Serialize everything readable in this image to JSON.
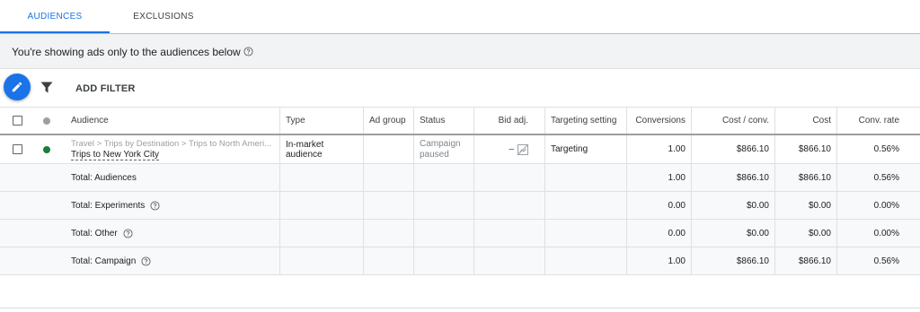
{
  "tabs": [
    {
      "label": "AUDIENCES",
      "active": true
    },
    {
      "label": "EXCLUSIONS",
      "active": false
    }
  ],
  "info_bar": {
    "text": "You're showing ads only to the audiences below"
  },
  "toolbar": {
    "edit_icon": "pencil-icon",
    "filter_icon": "filter-icon",
    "add_filter_label": "ADD FILTER"
  },
  "table": {
    "headers": {
      "audience": "Audience",
      "type": "Type",
      "ad_group": "Ad group",
      "status": "Status",
      "bid_adj": "Bid adj.",
      "targeting": "Targeting setting",
      "conversions": "Conversions",
      "cost_per_conv": "Cost / conv.",
      "cost": "Cost",
      "conv_rate": "Conv. rate"
    },
    "row": {
      "status_dot_color": "#188038",
      "audience_path": "Travel > Trips by Destination > Trips to North Ameri...",
      "audience_name": "Trips to New York City",
      "type": "In-market audience",
      "ad_group": "",
      "status_line1": "Campaign",
      "status_line2": "paused",
      "bid_adj": "–",
      "targeting": "Targeting",
      "conversions": "1.00",
      "cost_per_conv": "$866.10",
      "cost": "$866.10",
      "conv_rate": "0.56%"
    },
    "totals": [
      {
        "label": "Total: Audiences",
        "help": false,
        "conversions": "1.00",
        "cost_per_conv": "$866.10",
        "cost": "$866.10",
        "conv_rate": "0.56%"
      },
      {
        "label": "Total: Experiments",
        "help": true,
        "conversions": "0.00",
        "cost_per_conv": "$0.00",
        "cost": "$0.00",
        "conv_rate": "0.00%"
      },
      {
        "label": "Total: Other",
        "help": true,
        "conversions": "0.00",
        "cost_per_conv": "$0.00",
        "cost": "$0.00",
        "conv_rate": "0.00%"
      },
      {
        "label": "Total: Campaign",
        "help": true,
        "conversions": "1.00",
        "cost_per_conv": "$866.10",
        "cost": "$866.10",
        "conv_rate": "0.56%"
      }
    ]
  },
  "colors": {
    "accent": "#1a73e8",
    "enabled_status": "#188038",
    "total_row_bg": "#f8f9fa"
  }
}
